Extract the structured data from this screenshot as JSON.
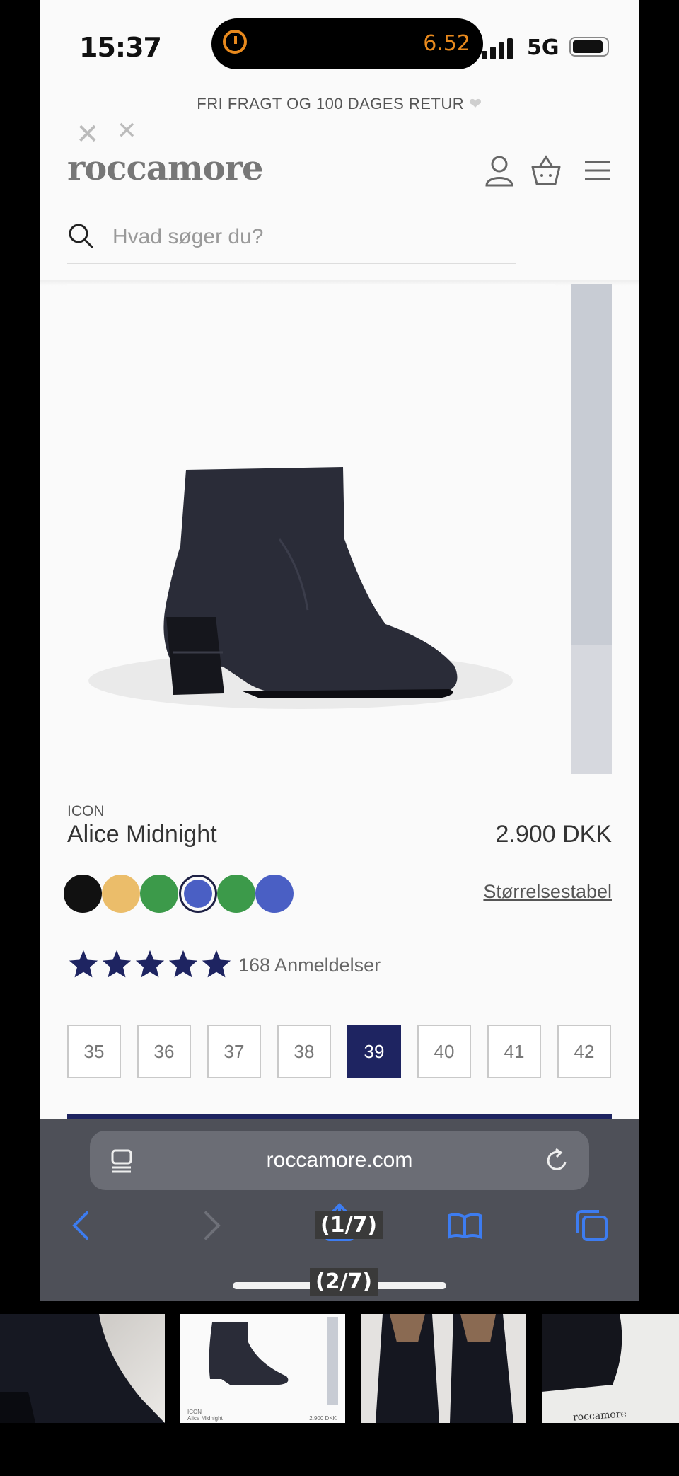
{
  "status": {
    "time": "15:37",
    "island_value": "6.52",
    "network": "5G"
  },
  "banner": {
    "text": "FRI FRAGT OG 100 DAGES RETUR"
  },
  "header": {
    "logo": "roccamore"
  },
  "search": {
    "placeholder": "Hvad søger du?"
  },
  "product": {
    "brand": "ICON",
    "name": "Alice Midnight",
    "price": "2.900 DKK",
    "size_guide": "Størrelsestabel",
    "rating": 5,
    "reviews": "168 Anmeldelser",
    "swatches": [
      "#111111",
      "#ebbd6a",
      "#3c9a4a",
      "#4a5fc4",
      "#3c9a4a",
      "#4a5fc4"
    ],
    "selected_swatch": 3,
    "sizes": [
      "35",
      "36",
      "37",
      "38",
      "39",
      "40",
      "41",
      "42"
    ],
    "selected_size": "39"
  },
  "safari": {
    "url": "roccamore.com"
  },
  "overlay": {
    "label_top": "(1/7)",
    "label_bottom": "(2/7)"
  },
  "thumbnails": {
    "t2_brand": "ICON",
    "t2_name": "Alice Midnight",
    "t2_price": "2.900 DKK",
    "t4_text": "roccamore"
  },
  "colors": {
    "accent": "#1e2461",
    "safari_bg": "#4e5058",
    "link_blue": "#3d7cf0"
  }
}
